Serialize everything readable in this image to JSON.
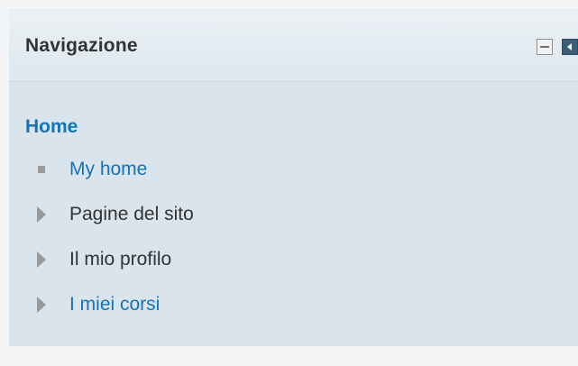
{
  "block": {
    "title": "Navigazione",
    "controls": {
      "minimize_icon": "minimize-icon",
      "dock_icon": "dock-left-icon"
    }
  },
  "navigation": {
    "home_label": "Home",
    "items": [
      {
        "label": "My home",
        "icon": "square-bullet-icon",
        "is_link": true
      },
      {
        "label": "Pagine del sito",
        "icon": "expand-arrow-icon",
        "is_link": false
      },
      {
        "label": "Il mio profilo",
        "icon": "expand-arrow-icon",
        "is_link": false
      },
      {
        "label": "I miei corsi",
        "icon": "expand-arrow-icon",
        "is_link": true
      }
    ]
  },
  "colors": {
    "link": "#1474b8",
    "text": "#333333",
    "block_background": "#d9e4ec",
    "dock_button": "#3b5e78"
  }
}
